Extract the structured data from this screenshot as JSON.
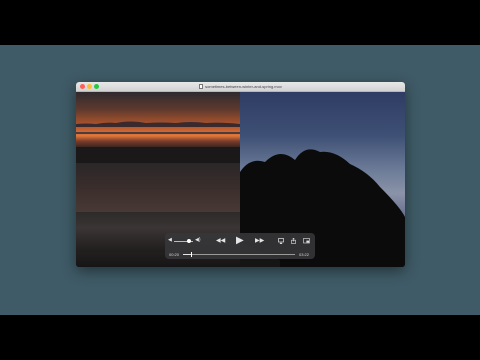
{
  "window": {
    "title": "sometimes-between-winter-and-spring.mov"
  },
  "player": {
    "volume": 0.8,
    "progress": 0.07,
    "elapsed": "00:20",
    "remaining": "03:22",
    "icons": {
      "volume_low": "volume-low-icon",
      "volume_high": "volume-high-icon",
      "rewind": "rewind-icon",
      "play": "play-icon",
      "fast_forward": "fast-forward-icon",
      "airplay": "airplay-icon",
      "share": "share-icon",
      "picture_in_picture": "picture-in-picture-icon"
    }
  },
  "colors": {
    "desktop": "#3f5b67",
    "controls_bg": "#37373a",
    "sunset": "#e2773a",
    "dusk_sky": "#3e5075"
  }
}
